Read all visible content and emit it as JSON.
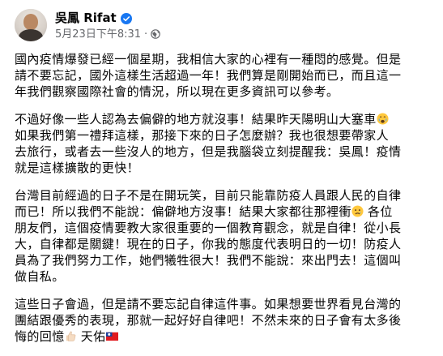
{
  "post": {
    "author": {
      "name": "吳鳳 Rifat",
      "verified": true,
      "avatar_icon": "avatar"
    },
    "meta": {
      "timestamp": "5月23日下午8:31",
      "separator": "·",
      "audience_icon": "globe-icon"
    },
    "paragraphs": [
      {
        "lines": [
          "國內疫情爆發已經一個星期，我相信大家的心裡有一種悶的感覺。但是",
          "請不要忘記，國外這樣生活超過一年！我們算是剛開始而已，而且這一",
          "年我們觀察國際社會的情況，所以現在更多資訊可以參考。"
        ]
      },
      {
        "lines": [
          "不過好像一些人認為去偏僻的地方就沒事！結果昨天陽明山大塞車",
          " 如果我們第一禮拜這樣，那接下來的日子怎麼辦？我也很想要帶家人",
          "去旅行，或者去一些沒人的地方，但是我腦袋立刻提醒我：吳鳳！疫情",
          "就是這樣擴散的更快！"
        ]
      },
      {
        "lines": [
          "台灣目前經過的日子不是在開玩笑，目前只能靠防疫人員跟人民的自律",
          "而已！所以我們不能說：偏僻地方沒事！結果大家都往那裡衝",
          "朋友們，這個疫情要教大家很重要的一個教育觀念，就是自律！從小長",
          "大，自律都是關鍵！現在的日子，你我的態度代表明日的一切！防疫人",
          "員為了我們努力工作，她們犧牲很大！我們不能說：來出門去！這個叫",
          "做自私。"
        ]
      },
      {
        "lines": [
          "這些日子會過，但是請不要忘記自律這件事。如果想要世界看見台灣的",
          "團結跟優秀的表現，那就一起好好自律吧！不然未來的日子會有太多後",
          "悔的回憶",
          "天佑"
        ]
      }
    ],
    "inline_tail": {
      "p3_line2_after_emoji": " 各位"
    },
    "emojis": {
      "crying_face": "crying-face-icon",
      "sad_face": "sad-face-icon",
      "thumbs_up": "thumbs-up-icon",
      "taiwan_flag": "taiwan-flag-icon"
    },
    "colors": {
      "text": "#050505",
      "meta": "#65676b",
      "verified_blue": "#1877f2",
      "background": "#ffffff"
    }
  }
}
